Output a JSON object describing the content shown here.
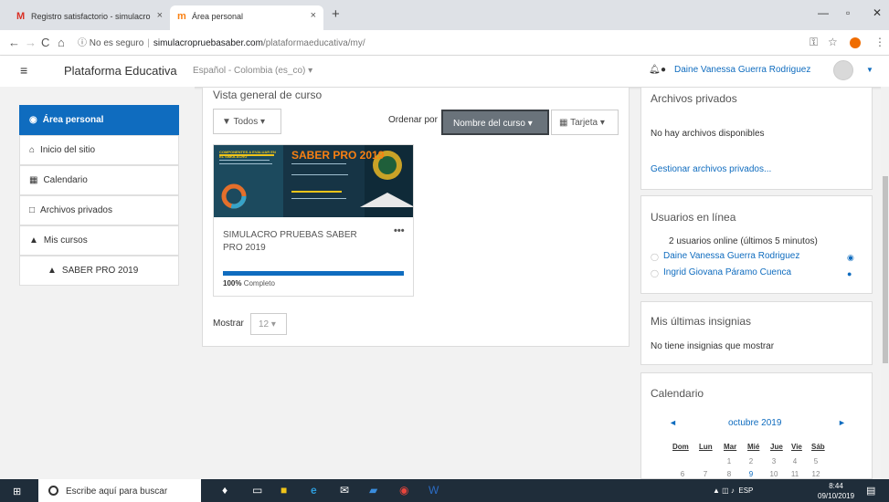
{
  "browser": {
    "tabs": [
      {
        "icon": "gmail-icon",
        "title": "Registro satisfactorio - simulacro"
      },
      {
        "icon": "moodle-icon",
        "title": "Área personal"
      }
    ],
    "security": "No es seguro",
    "url_domain": "simulacropruebasaber.com",
    "url_path": "/plataformaeducativa/my/"
  },
  "navbar": {
    "brand": "Plataforma Educativa",
    "language": "Español - Colombia (es_co) ▾",
    "user": "Daine Vanessa Guerra Rodriguez"
  },
  "drawer": {
    "items": [
      {
        "label": "Área personal",
        "icon": "dashboard-icon"
      },
      {
        "label": "Inicio del sitio",
        "icon": "home-icon"
      },
      {
        "label": "Calendario",
        "icon": "calendar-icon"
      },
      {
        "label": "Archivos privados",
        "icon": "file-icon"
      },
      {
        "label": "Mis cursos",
        "icon": "graduation-cap-icon"
      }
    ],
    "course": "SABER PRO 2019"
  },
  "main": {
    "title": "Vista general de curso",
    "filter": "Todos ▾",
    "order_label": "Ordenar por",
    "sort": "Nombre del curso ▾",
    "view": "Tarjeta ▾",
    "course": {
      "title": "SIMULACRO PRUEBAS SABER PRO 2019",
      "progress": 100,
      "progress_pct": "100%",
      "progress_text": "Completo",
      "image_text": "SABER PRO 2019",
      "image_heading": "COMPONENTES A EVALUAR EN EL SIMULACRO"
    },
    "show_label": "Mostrar",
    "show_value": "12 ▾"
  },
  "blocks": {
    "private_files": {
      "title": "Archivos privados",
      "empty": "No hay archivos disponibles",
      "manage": "Gestionar archivos privados..."
    },
    "online": {
      "title": "Usuarios en línea",
      "count": "2 usuarios online (últimos 5 minutos)",
      "users": [
        "Daine Vanessa Guerra Rodriguez",
        "Ingrid Giovana Páramo Cuenca"
      ]
    },
    "badges": {
      "title": "Mis últimas insignias",
      "empty": "No tiene insignias que mostrar"
    },
    "calendar": {
      "title": "Calendario",
      "month": "octubre 2019",
      "weekdays": [
        "Dom",
        "Lun",
        "Mar",
        "Mié",
        "Jue",
        "Vie",
        "Sáb"
      ],
      "row1": [
        "1",
        "2",
        "3",
        "4",
        "5"
      ],
      "row2": [
        "6",
        "7",
        "8",
        "9",
        "10",
        "11",
        "12"
      ]
    }
  },
  "taskbar": {
    "search": "Escribe aquí para buscar",
    "lang": "ESP",
    "time": "8:44",
    "date": "09/10/2019"
  }
}
